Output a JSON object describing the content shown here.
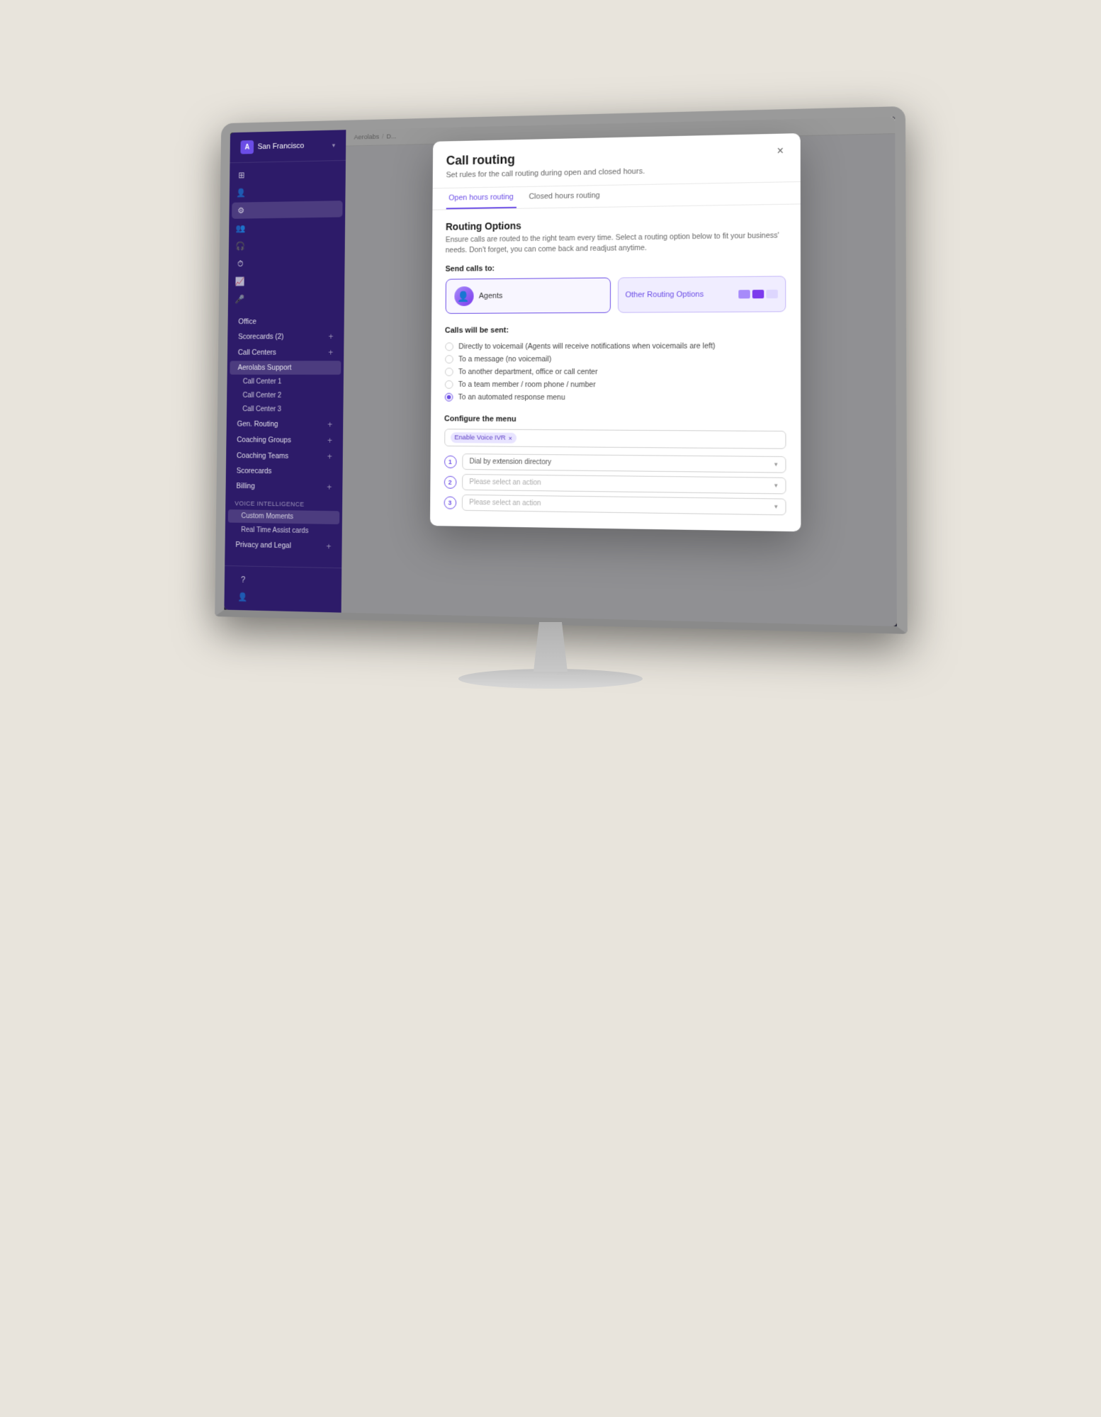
{
  "monitor": {
    "title": "Call routing modal on Aerolabs Support page"
  },
  "sidebar": {
    "org_name": "San Francisco",
    "nav_items": [
      {
        "label": "Office",
        "type": "main",
        "indent": 0
      },
      {
        "label": "Scorecards (2)",
        "type": "main",
        "badge": "2",
        "indent": 0
      },
      {
        "label": "Call Centers",
        "type": "main",
        "indent": 0
      },
      {
        "label": "Aerolabs Support",
        "type": "main",
        "active": true,
        "indent": 0
      },
      {
        "label": "Call Center 1",
        "type": "sub",
        "indent": 1
      },
      {
        "label": "Call Center 2",
        "type": "sub",
        "indent": 1
      },
      {
        "label": "Call Center 3",
        "type": "sub",
        "indent": 1
      },
      {
        "label": "Gen. Routing",
        "type": "main",
        "indent": 0
      },
      {
        "label": "Coaching Groups",
        "type": "main",
        "indent": 0
      },
      {
        "label": "Coaching Teams",
        "type": "main",
        "indent": 0
      },
      {
        "label": "Scorecards",
        "type": "main",
        "indent": 0
      },
      {
        "label": "Billing",
        "type": "main",
        "indent": 0
      },
      {
        "label": "Voice Intelligence",
        "type": "section"
      },
      {
        "label": "Custom Moments",
        "type": "sub-active",
        "indent": 1
      },
      {
        "label": "Real Time Assist cards",
        "type": "sub",
        "indent": 1
      },
      {
        "label": "Privacy and Legal",
        "type": "main",
        "indent": 0
      }
    ]
  },
  "breadcrumb": {
    "parts": [
      "Aerolabs",
      "D..."
    ]
  },
  "modal": {
    "title": "Call routing",
    "subtitle": "Set rules for the call routing during open and closed hours.",
    "close_label": "×",
    "tabs": [
      {
        "label": "Open hours routing",
        "active": true
      },
      {
        "label": "Closed hours routing",
        "active": false
      }
    ],
    "routing_options_title": "Routing Options",
    "routing_options_desc": "Ensure calls are routed to the right team every time. Select a routing option below to fit your business' needs. Don't forget, you can come back and readjust anytime.",
    "send_calls_to_label": "Send calls to:",
    "routing_cards": [
      {
        "label": "Agents",
        "active": true
      },
      {
        "label": "Other Routing Options",
        "active": false
      }
    ],
    "calls_will_be_sent_label": "Calls will be sent:",
    "radio_options": [
      {
        "label": "Directly to voicemail (Agents will receive notifications when voicemails are left)",
        "checked": false
      },
      {
        "label": "To a message (no voicemail)",
        "checked": false
      },
      {
        "label": "To another department, office or call center",
        "checked": false
      },
      {
        "label": "To a team member / room phone / number",
        "checked": false
      },
      {
        "label": "To an automated response menu",
        "checked": true
      }
    ],
    "configure_menu_title": "Configure the menu",
    "tag_label": "Enable Voice IVR",
    "menu_rows": [
      {
        "number": "1",
        "value": "Dial by extension directory",
        "placeholder": "Dial by extension directory"
      },
      {
        "number": "2",
        "value": "",
        "placeholder": "Please select an action"
      },
      {
        "number": "3",
        "value": "",
        "placeholder": "Please select an action"
      }
    ]
  }
}
